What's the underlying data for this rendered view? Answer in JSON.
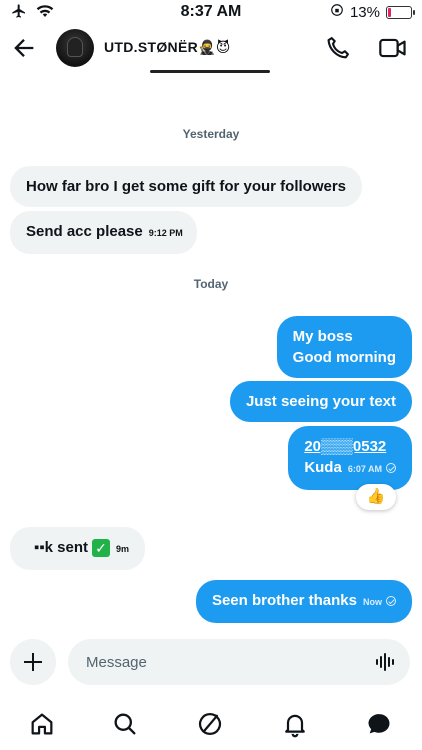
{
  "status": {
    "time": "8:37 AM",
    "battery": "13%",
    "battery_level": 0.13
  },
  "header": {
    "contact_name": "UTD.STØNËR🥷😈"
  },
  "chat": {
    "separators": {
      "yesterday": "Yesterday",
      "today": "Today"
    },
    "messages": {
      "m1": {
        "text": "How far bro I get some gift for your followers"
      },
      "m2": {
        "text": "Send acc please",
        "time": "9:12 PM"
      },
      "m3": {
        "line1": "My boss",
        "line2": "Good morning"
      },
      "m4": {
        "text": "Just seeing your text"
      },
      "m5": {
        "line1": "20▒▒▒0532",
        "line2": "Kuda",
        "time": "6:07 AM",
        "reaction": "👍"
      },
      "m6": {
        "text": "▪▪k sent",
        "emoji": "✓",
        "time": "9m"
      },
      "m7": {
        "text": "Seen brother thanks",
        "time": "Now"
      }
    }
  },
  "composer": {
    "placeholder": "Message"
  },
  "colors": {
    "accent": "#1d9bf0",
    "incoming": "#eff3f4",
    "muted": "#536471"
  },
  "icons": [
    "back-arrow-icon",
    "phone-icon",
    "video-icon",
    "plus-icon",
    "voice-icon",
    "home-icon",
    "search-icon",
    "grok-icon",
    "bell-icon",
    "messages-icon"
  ]
}
